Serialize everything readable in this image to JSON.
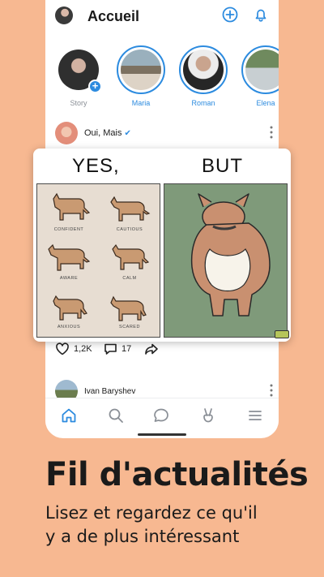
{
  "header": {
    "title": "Accueil",
    "icons": [
      "profile-avatar",
      "plus-icon",
      "bell-icon"
    ]
  },
  "stories": [
    {
      "label": "Story",
      "own": true
    },
    {
      "label": "Maria"
    },
    {
      "label": "Roman"
    },
    {
      "label": "Elena"
    }
  ],
  "post": {
    "author": "Oui, Mais",
    "verified": true,
    "meme": {
      "left_title": "YES,",
      "right_title": "BUT",
      "dog_labels": [
        "CONFIDENT",
        "CAUTIOUS",
        "AWARE",
        "CALM",
        "ANXIOUS",
        "SCARED"
      ]
    },
    "likes": "1,2K",
    "comments": "17"
  },
  "next_post": {
    "author": "Ivan Baryshev"
  },
  "tabbar": [
    "home-icon",
    "search-icon",
    "chat-icon",
    "peace-icon",
    "menu-icon"
  ],
  "colors": {
    "accent": "#2c8bdf",
    "background": "#f7b891"
  },
  "promo": {
    "headline": "Fil d'actualités",
    "subline_1": "Lisez et regardez ce qu'il",
    "subline_2": "y a de plus intéressant"
  }
}
